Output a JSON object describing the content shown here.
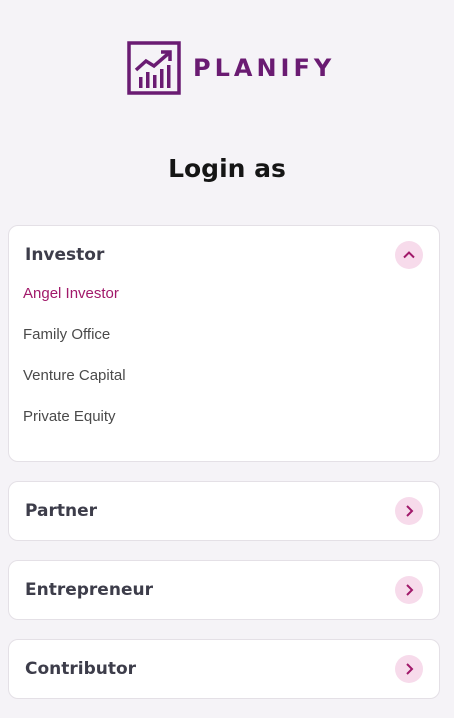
{
  "brand": {
    "name": "PLANIFY",
    "color": "#6a1b72"
  },
  "page": {
    "title": "Login as"
  },
  "accent": "#a1196a",
  "roles": [
    {
      "label": "Investor",
      "expanded": true,
      "chevron_icon": "chevron-up-icon",
      "items": [
        {
          "label": "Angel Investor",
          "selected": true
        },
        {
          "label": "Family Office",
          "selected": false
        },
        {
          "label": "Venture Capital",
          "selected": false
        },
        {
          "label": "Private Equity",
          "selected": false
        }
      ]
    },
    {
      "label": "Partner",
      "expanded": false,
      "chevron_icon": "chevron-right-icon"
    },
    {
      "label": "Entrepreneur",
      "expanded": false,
      "chevron_icon": "chevron-right-icon"
    },
    {
      "label": "Contributor",
      "expanded": false,
      "chevron_icon": "chevron-right-icon"
    }
  ]
}
